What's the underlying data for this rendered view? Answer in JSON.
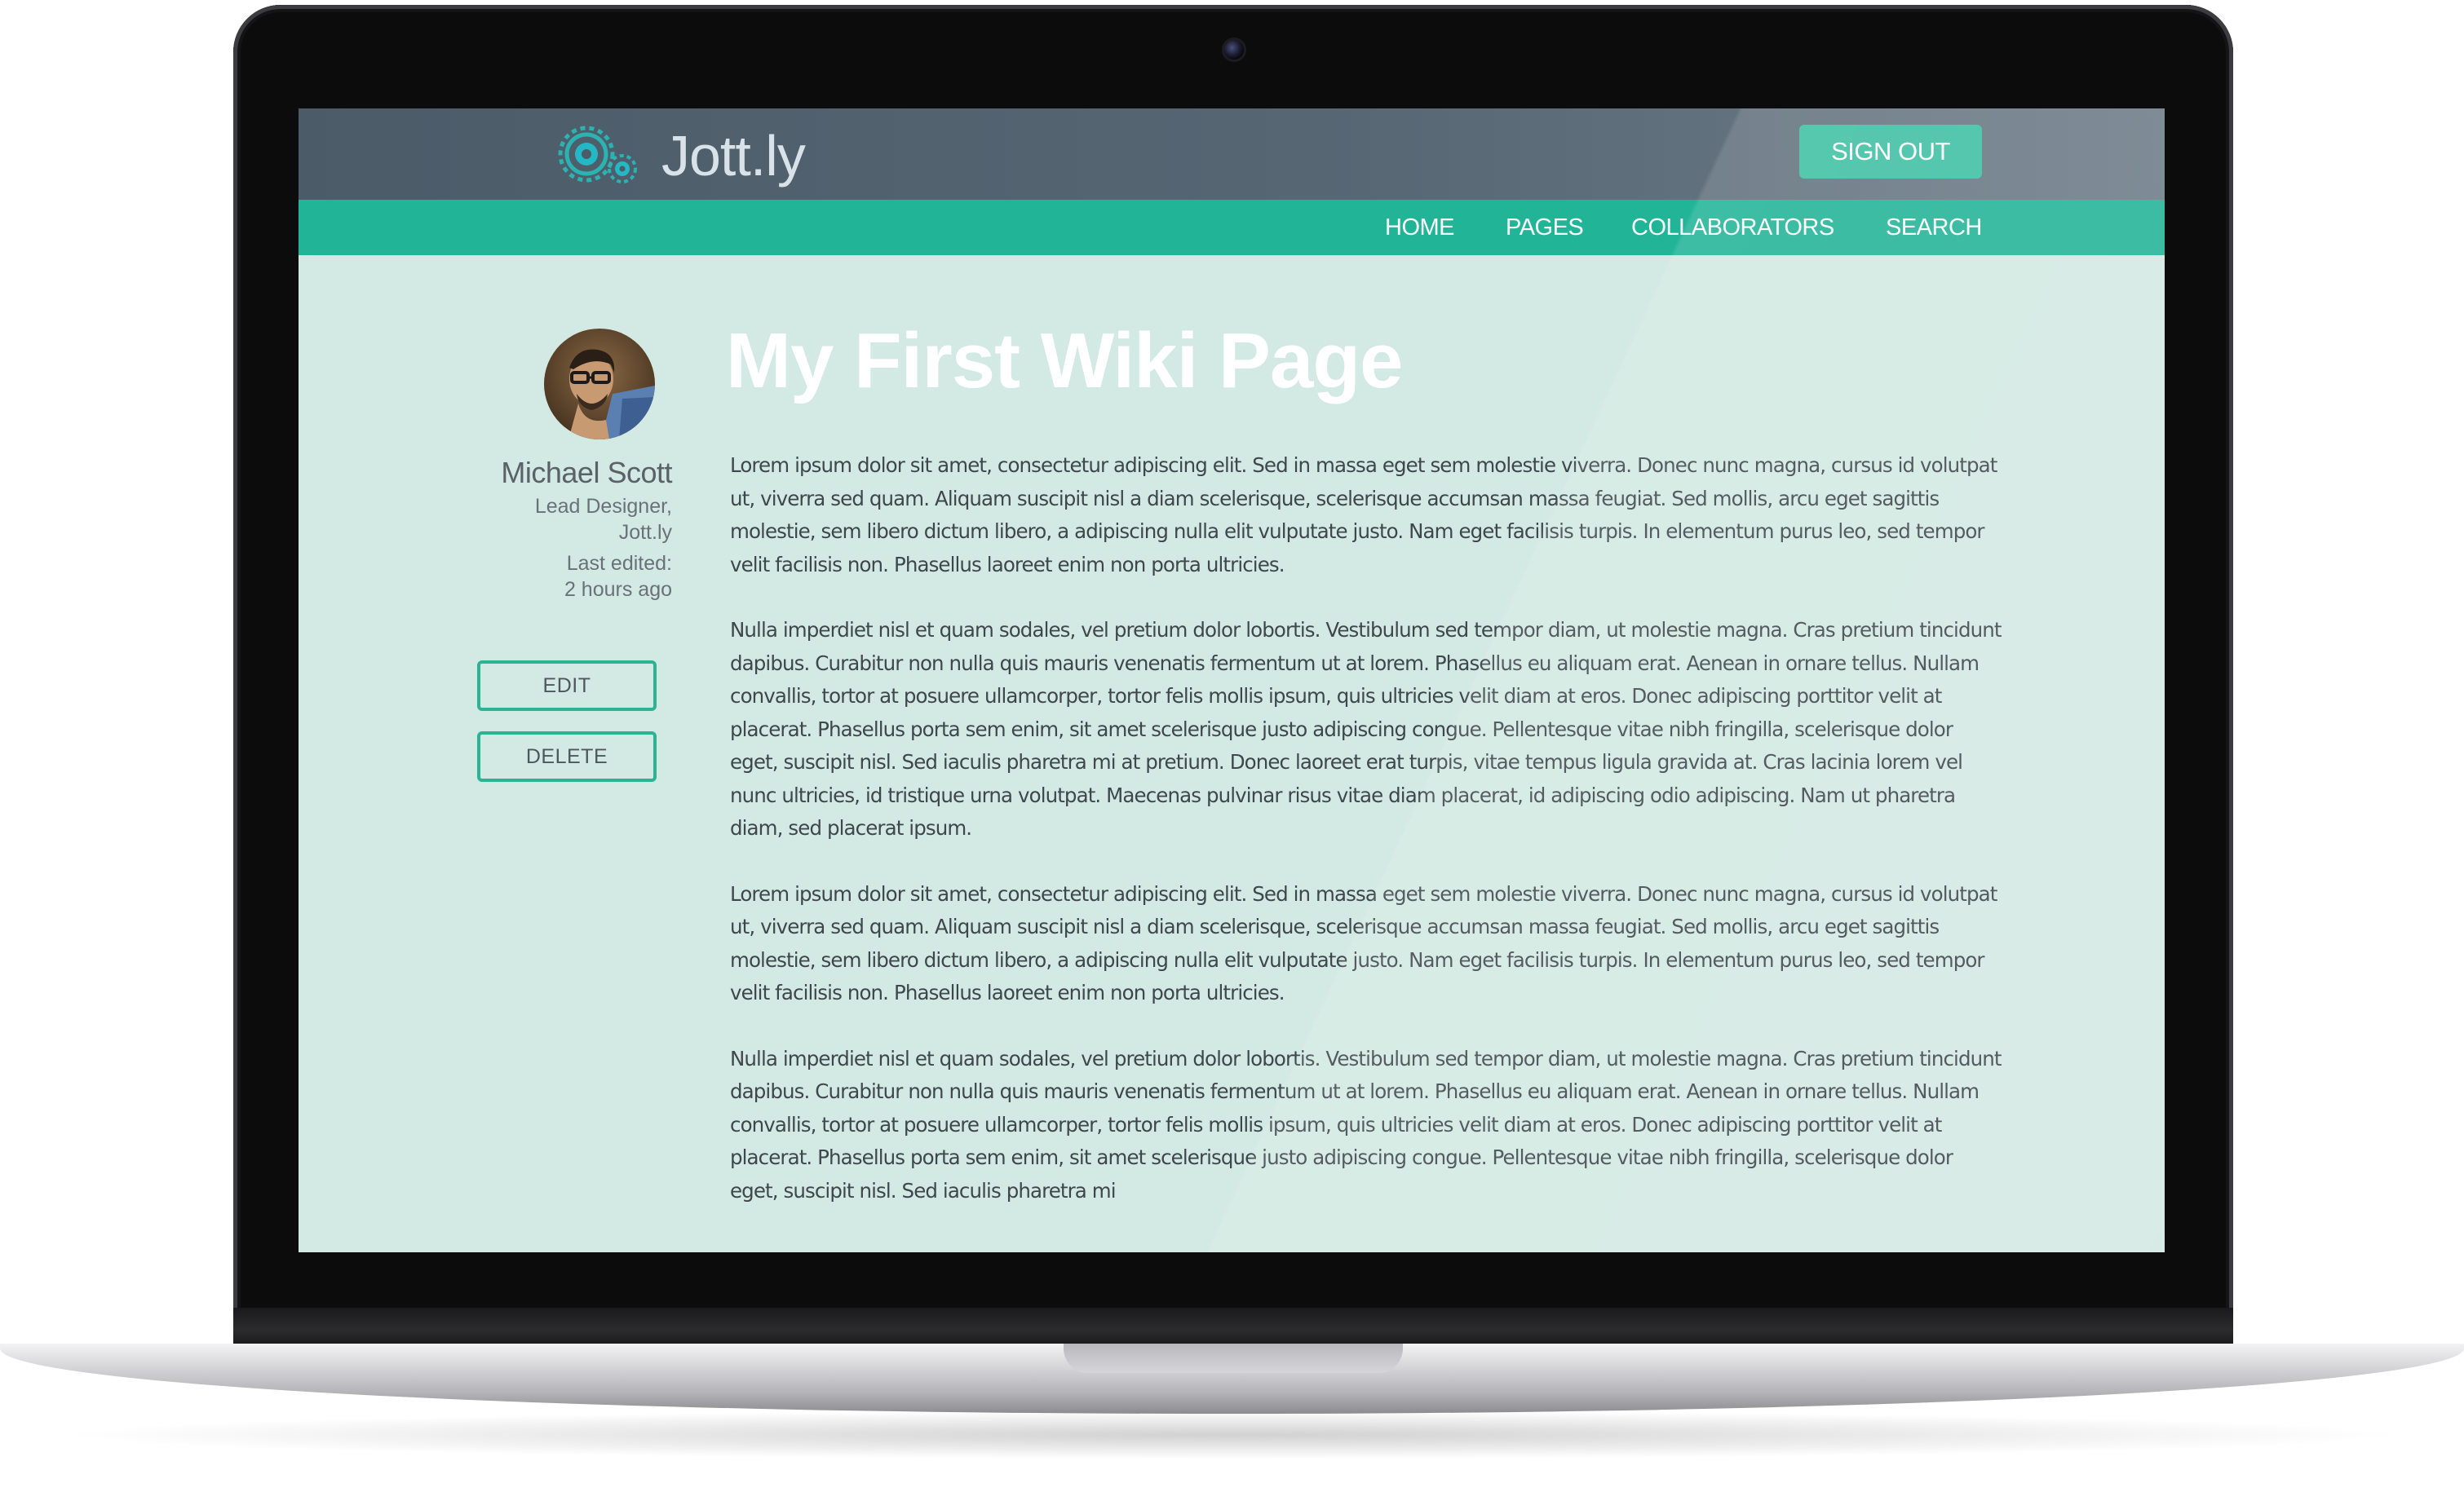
{
  "app": {
    "name": "Jott.ly",
    "accent_color": "#22b497",
    "topbar_color": "#4b5b68"
  },
  "header": {
    "logo_icon": "gear-logo-icon",
    "logo_text": "Jott.ly",
    "sign_out_label": "SIGN OUT"
  },
  "nav": {
    "items": [
      {
        "label": "HOME"
      },
      {
        "label": "PAGES"
      },
      {
        "label": "COLLABORATORS"
      },
      {
        "label": "SEARCH"
      }
    ]
  },
  "author": {
    "name": "Michael Scott",
    "role": "Lead Designer,",
    "company": "Jott.ly",
    "last_edited_label": "Last edited:",
    "last_edited_value": "2 hours ago"
  },
  "actions": {
    "edit_label": "EDIT",
    "delete_label": "DELETE"
  },
  "page": {
    "title": "My First Wiki Page",
    "paragraphs": [
      "Lorem ipsum dolor sit amet, consectetur adipiscing elit. Sed in massa eget sem molestie viverra. Donec nunc magna, cursus id volutpat ut, viverra sed quam. Aliquam suscipit nisl a diam scelerisque, scelerisque accumsan massa feugiat. Sed mollis, arcu eget sagittis molestie, sem libero dictum libero, a adipiscing nulla elit vulputate justo. Nam eget facilisis turpis. In elementum purus leo, sed tempor velit facilisis non. Phasellus laoreet enim non porta ultricies.",
      "Nulla imperdiet nisl et quam sodales, vel pretium dolor lobortis. Vestibulum sed tempor diam, ut molestie magna. Cras pretium tincidunt dapibus. Curabitur non nulla quis mauris venenatis fermentum ut at lorem. Phasellus eu aliquam erat. Aenean in ornare tellus. Nullam convallis, tortor at posuere ullamcorper, tortor felis mollis ipsum, quis ultricies velit diam at eros. Donec adipiscing porttitor velit at placerat. Phasellus porta sem enim, sit amet scelerisque justo adipiscing congue. Pellentesque vitae nibh fringilla, scelerisque dolor eget, suscipit nisl. Sed iaculis pharetra mi at pretium. Donec laoreet erat turpis, vitae tempus ligula gravida at. Cras lacinia lorem vel nunc ultricies, id tristique urna volutpat. Maecenas pulvinar risus vitae diam placerat, id adipiscing odio adipiscing. Nam ut pharetra diam, sed placerat ipsum.",
      "Lorem ipsum dolor sit amet, consectetur adipiscing elit. Sed in massa eget sem molestie viverra. Donec nunc magna, cursus id volutpat ut, viverra sed quam. Aliquam suscipit nisl a diam scelerisque, scelerisque accumsan massa feugiat. Sed mollis, arcu eget sagittis molestie, sem libero dictum libero, a adipiscing nulla elit vulputate justo. Nam eget facilisis turpis. In elementum purus leo, sed tempor velit facilisis non. Phasellus laoreet enim non porta ultricies.",
      "Nulla imperdiet nisl et quam sodales, vel pretium dolor lobortis. Vestibulum sed tempor diam, ut molestie magna. Cras pretium tincidunt dapibus. Curabitur non nulla quis mauris venenatis fermentum ut at lorem. Phasellus eu aliquam erat. Aenean in ornare tellus. Nullam convallis, tortor at posuere ullamcorper, tortor felis mollis ipsum, quis ultricies velit diam at eros. Donec adipiscing porttitor velit at placerat. Phasellus porta sem enim, sit amet scelerisque justo adipiscing congue. Pellentesque vitae nibh fringilla, scelerisque dolor eget, suscipit nisl. Sed iaculis pharetra mi"
    ]
  }
}
